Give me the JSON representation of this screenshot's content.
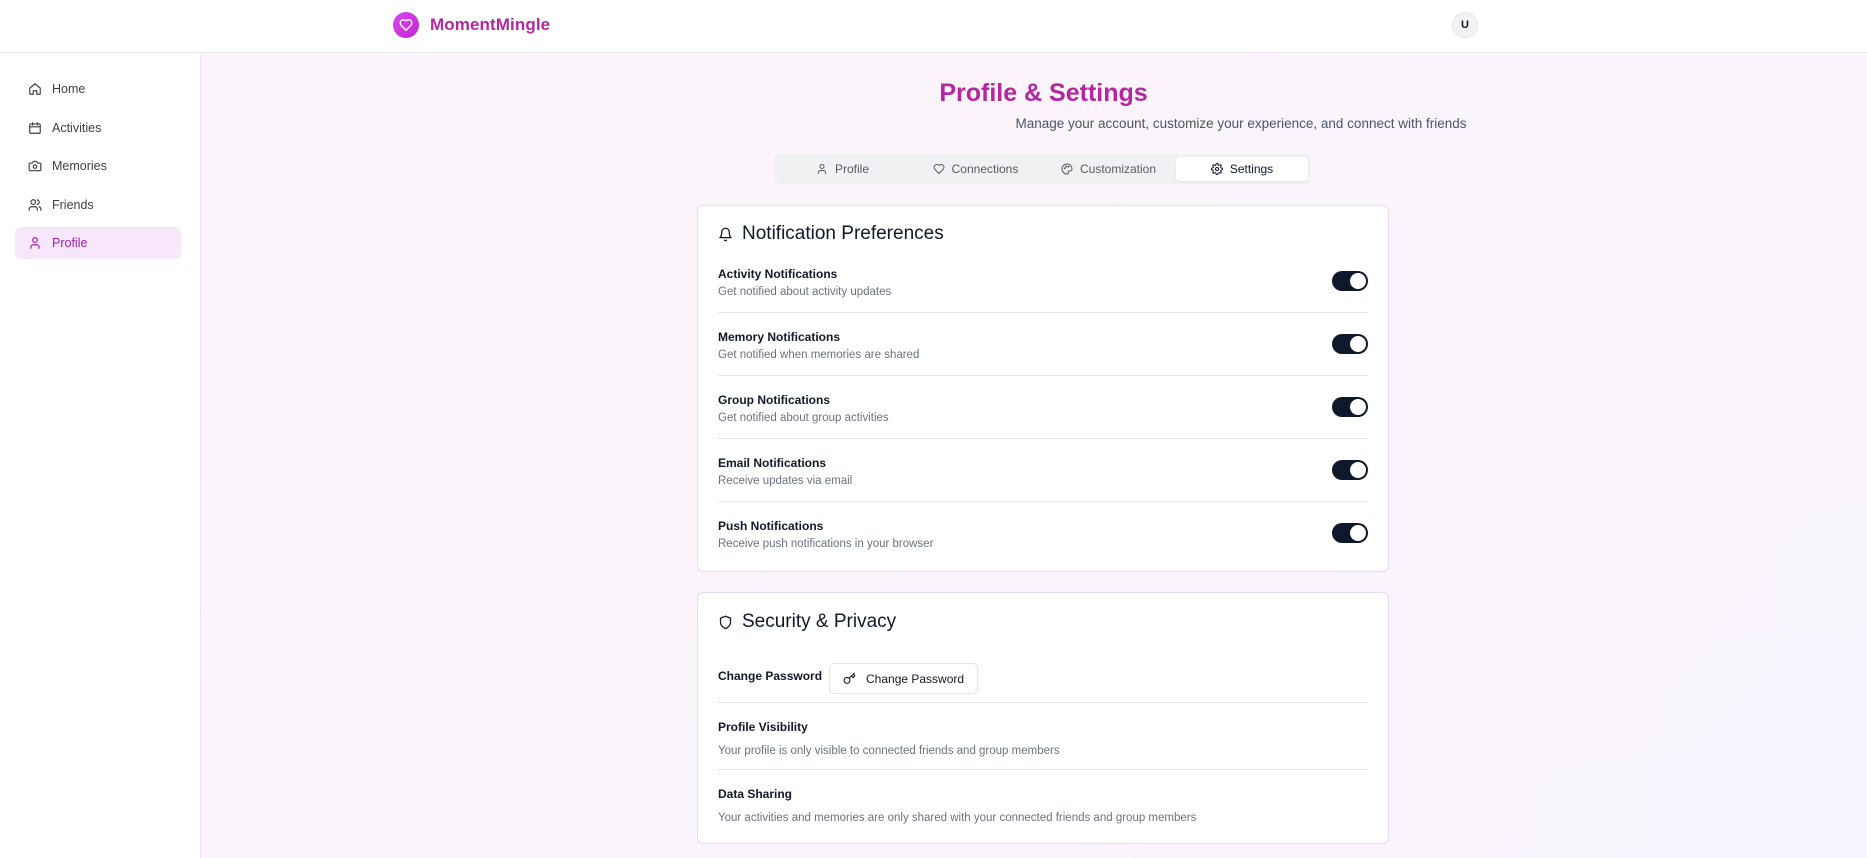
{
  "header": {
    "brand": "MomentMingle",
    "avatar_initial": "U"
  },
  "sidebar": {
    "items": [
      {
        "label": "Home",
        "icon": "home-icon"
      },
      {
        "label": "Activities",
        "icon": "calendar-icon"
      },
      {
        "label": "Memories",
        "icon": "camera-icon"
      },
      {
        "label": "Friends",
        "icon": "users-icon"
      },
      {
        "label": "Profile",
        "icon": "user-icon",
        "active": true
      }
    ]
  },
  "page": {
    "title": "Profile & Settings",
    "subtitle": "Manage your account, customize your experience, and connect with friends"
  },
  "tabs": [
    {
      "label": "Profile",
      "icon": "user-icon"
    },
    {
      "label": "Connections",
      "icon": "heart-icon"
    },
    {
      "label": "Customization",
      "icon": "palette-icon"
    },
    {
      "label": "Settings",
      "icon": "gear-icon",
      "active": true
    }
  ],
  "notifications": {
    "title": "Notification Preferences",
    "items": [
      {
        "label": "Activity Notifications",
        "desc": "Get notified about activity updates",
        "enabled": true
      },
      {
        "label": "Memory Notifications",
        "desc": "Get notified when memories are shared",
        "enabled": true
      },
      {
        "label": "Group Notifications",
        "desc": "Get notified about group activities",
        "enabled": true
      },
      {
        "label": "Email Notifications",
        "desc": "Receive updates via email",
        "enabled": true
      },
      {
        "label": "Push Notifications",
        "desc": "Receive push notifications in your browser",
        "enabled": true
      }
    ]
  },
  "security": {
    "title": "Security & Privacy",
    "password_label": "Change Password",
    "password_button": "Change Password",
    "visibility_label": "Profile Visibility",
    "visibility_desc": "Your profile is only visible to connected friends and group members",
    "sharing_label": "Data Sharing",
    "sharing_desc": "Your activities and memories are only shared with your connected friends and group members"
  },
  "colors": {
    "brand": "#b5269f",
    "accent": "#d946ef",
    "toggle_on": "#0f172a",
    "active_nav_bg": "#f6e8fa"
  }
}
